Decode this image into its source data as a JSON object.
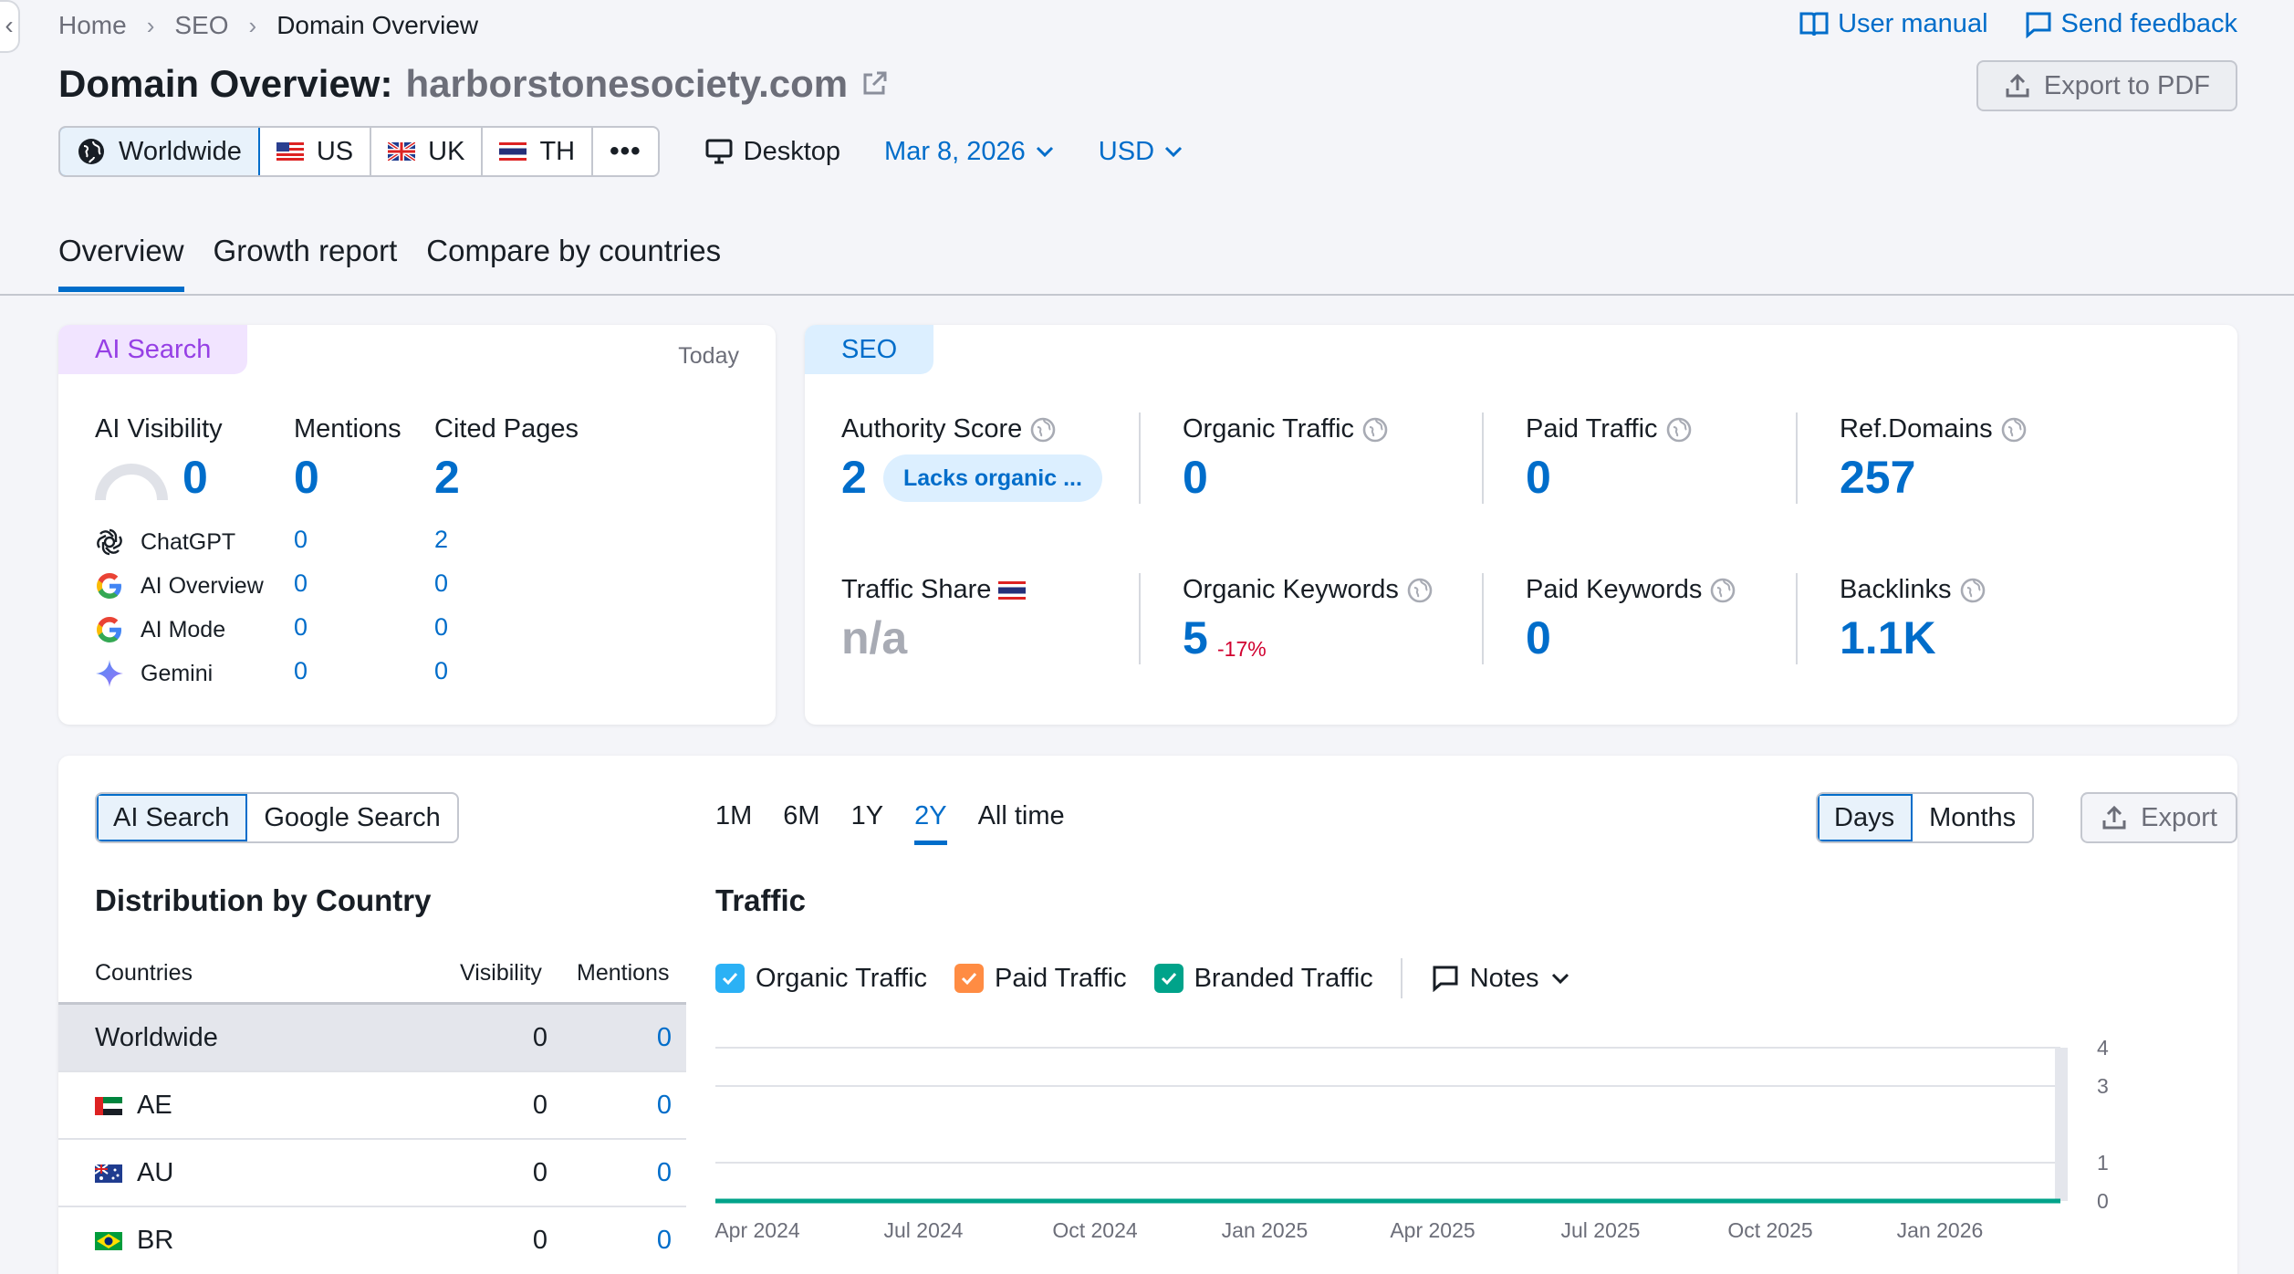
{
  "breadcrumb": {
    "home": "Home",
    "seo": "SEO",
    "current": "Domain Overview"
  },
  "top_links": {
    "manual": "User manual",
    "feedback": "Send feedback"
  },
  "title": {
    "prefix": "Domain Overview:",
    "domain": "harborstonesociety.com"
  },
  "export_pdf": "Export to PDF",
  "databases": [
    {
      "label": "Worldwide",
      "active": true
    },
    {
      "label": "US"
    },
    {
      "label": "UK"
    },
    {
      "label": "TH"
    }
  ],
  "more_icon": "more-dots-icon",
  "device": "Desktop",
  "date": "Mar 8, 2026",
  "currency": "USD",
  "tabs": [
    "Overview",
    "Growth report",
    "Compare by countries"
  ],
  "ai_card": {
    "tag": "AI Search",
    "today": "Today",
    "metrics": [
      {
        "label": "AI Visibility",
        "value": "0"
      },
      {
        "label": "Mentions",
        "value": "0"
      },
      {
        "label": "Cited Pages",
        "value": "2"
      }
    ],
    "sources": [
      {
        "name": "ChatGPT",
        "mentions": "0",
        "cited": "2",
        "icon": "chatgpt-icon"
      },
      {
        "name": "AI Overview",
        "mentions": "0",
        "cited": "0",
        "icon": "google-icon"
      },
      {
        "name": "AI Mode",
        "mentions": "0",
        "cited": "0",
        "icon": "google-icon"
      },
      {
        "name": "Gemini",
        "mentions": "0",
        "cited": "0",
        "icon": "gemini-icon"
      }
    ]
  },
  "seo_card": {
    "tag": "SEO",
    "authority": {
      "label": "Authority Score",
      "value": "2",
      "pill": "Lacks organic ..."
    },
    "organic_traffic": {
      "label": "Organic Traffic",
      "value": "0"
    },
    "paid_traffic": {
      "label": "Paid Traffic",
      "value": "0"
    },
    "ref_domains": {
      "label": "Ref.Domains",
      "value": "257"
    },
    "traffic_share": {
      "label": "Traffic Share",
      "value": "n/a"
    },
    "organic_keywords": {
      "label": "Organic Keywords",
      "value": "5",
      "delta": "-17%"
    },
    "paid_keywords": {
      "label": "Paid Keywords",
      "value": "0"
    },
    "backlinks": {
      "label": "Backlinks",
      "value": "1.1K"
    }
  },
  "bottom": {
    "search_toggle": [
      "AI Search",
      "Google Search"
    ],
    "periods": [
      "1M",
      "6M",
      "1Y",
      "2Y",
      "All time"
    ],
    "active_period": "2Y",
    "granularity": [
      "Days",
      "Months"
    ],
    "export": "Export",
    "dist_title": "Distribution by Country",
    "table_headers": {
      "countries": "Countries",
      "visibility": "Visibility",
      "mentions": "Mentions"
    },
    "rows": [
      {
        "country": "Worldwide",
        "visibility": "0",
        "mentions": "0",
        "flag": ""
      },
      {
        "country": "AE",
        "visibility": "0",
        "mentions": "0",
        "flag": "ae"
      },
      {
        "country": "AU",
        "visibility": "0",
        "mentions": "0",
        "flag": "au"
      },
      {
        "country": "BR",
        "visibility": "0",
        "mentions": "0",
        "flag": "br"
      }
    ],
    "traffic_title": "Traffic",
    "legend": [
      {
        "label": "Organic Traffic",
        "color": "#2bb1f5"
      },
      {
        "label": "Paid Traffic",
        "color": "#ff8c43"
      },
      {
        "label": "Branded Traffic",
        "color": "#00a38a"
      }
    ],
    "notes": "Notes"
  },
  "chart_data": {
    "type": "line",
    "x_labels": [
      "Apr 2024",
      "Jul 2024",
      "Oct 2024",
      "Jan 2025",
      "Apr 2025",
      "Jul 2025",
      "Oct 2025",
      "Jan 2026"
    ],
    "y_ticks": [
      "4",
      "3",
      "1",
      "0"
    ],
    "series": [
      {
        "name": "Branded Traffic",
        "color": "#00a38a",
        "values": [
          0,
          0,
          0,
          0,
          0,
          0,
          0,
          0
        ]
      }
    ]
  }
}
